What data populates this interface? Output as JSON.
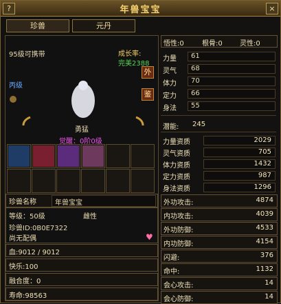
{
  "window": {
    "title": "年兽宝宝",
    "help_label": "?",
    "close_label": "×"
  },
  "tabs": [
    {
      "label": "珍兽"
    },
    {
      "label": "元丹"
    }
  ],
  "pet": {
    "level_carry": "95级可携带",
    "growth_label": "成长率:",
    "growth_value": "完美2388",
    "grade": "丙级",
    "temperament": "勇猛",
    "awaken": "觉醒：0阶0级",
    "btn_outer": "外",
    "btn_appraise": "鉴",
    "name_label": "珍兽名称",
    "name_value": "年兽宝宝",
    "level_line": "等级：50级",
    "gender": "雌性",
    "pet_id": "珍兽ID:0B0E7322",
    "spouse": "尚无配偶",
    "hp": "血:9012 / 9012",
    "happy": "快乐:100",
    "fusion": "融合度：0",
    "lifespan": "寿命:98563"
  },
  "top_stats": {
    "wuxing": "悟性:0",
    "genggu": "根骨:0",
    "lingxing": "灵性:0"
  },
  "attributes": [
    {
      "label": "力量",
      "value": "61"
    },
    {
      "label": "灵气",
      "value": "68"
    },
    {
      "label": "体力",
      "value": "70"
    },
    {
      "label": "定力",
      "value": "66"
    },
    {
      "label": "身法",
      "value": "55"
    }
  ],
  "potential": {
    "label": "潜能:",
    "value": "245"
  },
  "aptitudes": [
    {
      "label": "力量资质",
      "value": "2029"
    },
    {
      "label": "灵气资质",
      "value": "705"
    },
    {
      "label": "体力资质",
      "value": "1432"
    },
    {
      "label": "定力资质",
      "value": "987"
    },
    {
      "label": "身法资质",
      "value": "1296"
    }
  ],
  "combat": [
    {
      "label": "外功攻击:",
      "value": "4874"
    },
    {
      "label": "内功攻击:",
      "value": "4039"
    },
    {
      "label": "外功防御:",
      "value": "4533"
    },
    {
      "label": "内功防御:",
      "value": "4154"
    },
    {
      "label": "闪避:",
      "value": "376"
    },
    {
      "label": "命中:",
      "value": "1132"
    },
    {
      "label": "会心攻击:",
      "value": "14"
    },
    {
      "label": "会心防御:",
      "value": "14"
    }
  ]
}
